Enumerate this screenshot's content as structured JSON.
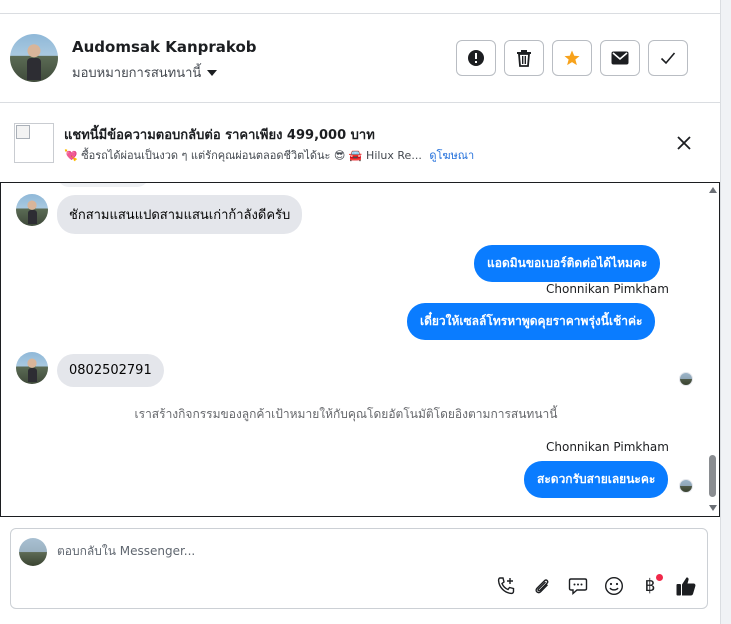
{
  "header": {
    "user_name": "Audomsak Kanprakob",
    "assign_label": "มอบหมายการสนทนานี้",
    "actions": [
      {
        "name": "report-icon"
      },
      {
        "name": "trash-icon"
      },
      {
        "name": "star-icon",
        "color": "#f7a21b"
      },
      {
        "name": "mail-icon"
      },
      {
        "name": "check-icon"
      }
    ]
  },
  "ad": {
    "title": "แชทนี้มีข้อความตอบกลับต่อ ราคาเพียง 499,000 บาท",
    "subtitle": "💘 ซื้อรถได้ผ่อนเป็นงวด ๆ แต่รักคุณผ่อนตลอดชีวิตได้นะ 😎 🚘 Hilux Re...",
    "link": "ดูโฆษณา"
  },
  "messages": {
    "m1": "ชักสามแสนแปดสามแสนเก่าก้าลังดีครับ",
    "m2": "แอดมินขอเบอร์ติดต่อได้ไหมคะ",
    "sender1": "Chonnikan Pimkham",
    "m3": "เดี๋ยวให้เซลล์โทรหาพูดคุยราคาพรุ่งนี้เช้าค่ะ",
    "m4": "0802502791",
    "system_note": "เราสร้างกิจกรรมของลูกค้าเป้าหมายให้กับคุณโดยอัตโนมัติโดยอิงตามการสนทนานี้",
    "sender2": "Chonnikan Pimkham",
    "m5": "สะดวกรับสายเลยนะคะ"
  },
  "composer": {
    "placeholder": "ตอบกลับใน Messenger...",
    "tools": [
      "phone-plus-icon",
      "paperclip-icon",
      "saved-reply-icon",
      "emoji-icon",
      "baht-icon",
      "thumbs-up-icon"
    ],
    "baht_symbol": "฿"
  },
  "colors": {
    "outgoing": "#0a7cff",
    "incoming": "#e4e6eb",
    "accent_star": "#f7a21b",
    "notification_dot": "#f02849"
  }
}
